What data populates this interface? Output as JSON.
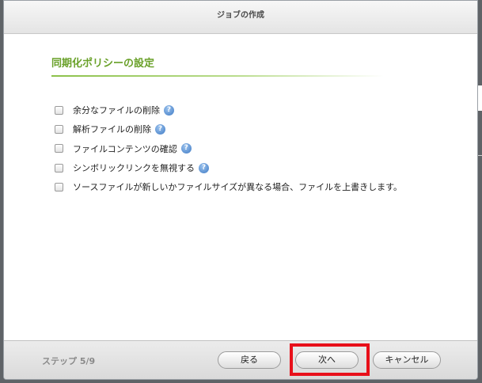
{
  "dialog": {
    "title": "ジョブの作成"
  },
  "section": {
    "title": "同期化ポリシーの設定"
  },
  "options": [
    {
      "label": "余分なファイルの削除",
      "checked": false,
      "help": true
    },
    {
      "label": "解析ファイルの削除",
      "checked": false,
      "help": true
    },
    {
      "label": "ファイルコンテンツの確認",
      "checked": false,
      "help": true
    },
    {
      "label": "シンボリックリンクを無視する",
      "checked": false,
      "help": true
    },
    {
      "label": "ソースファイルが新しいかファイルサイズが異なる場合、ファイルを上書きします。",
      "checked": false,
      "help": false
    }
  ],
  "help_glyph": "?",
  "footer": {
    "step": "ステップ 5/9",
    "back_label": "戻る",
    "next_label": "次へ",
    "cancel_label": "キャンセル"
  },
  "colors": {
    "section_title": "#6aa12a",
    "highlight": "#e8101a",
    "help_icon": "#3d79c4"
  }
}
